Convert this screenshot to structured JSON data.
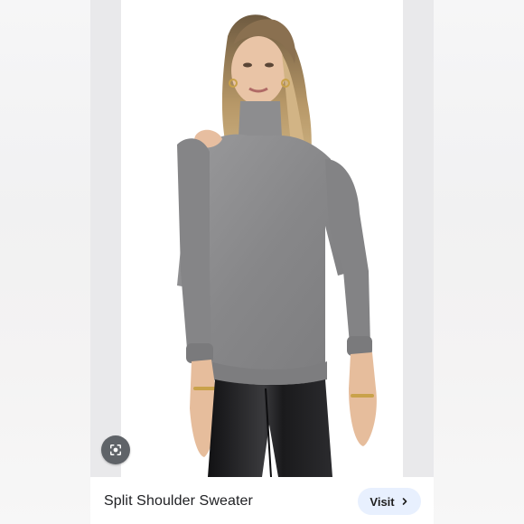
{
  "result": {
    "title": "Split Shoulder Sweater",
    "visit_label": "Visit",
    "image_alt": "Split shoulder grey turtleneck sweater worn by model with black leather pants"
  },
  "icons": {
    "lens": "google-lens-icon",
    "chevron": "chevron-right-icon"
  },
  "colors": {
    "visit_bg": "#e8f0fe",
    "lens_bg": "#5f6368",
    "sweater": "#8a8a8c",
    "pants": "#1b1b1d"
  }
}
